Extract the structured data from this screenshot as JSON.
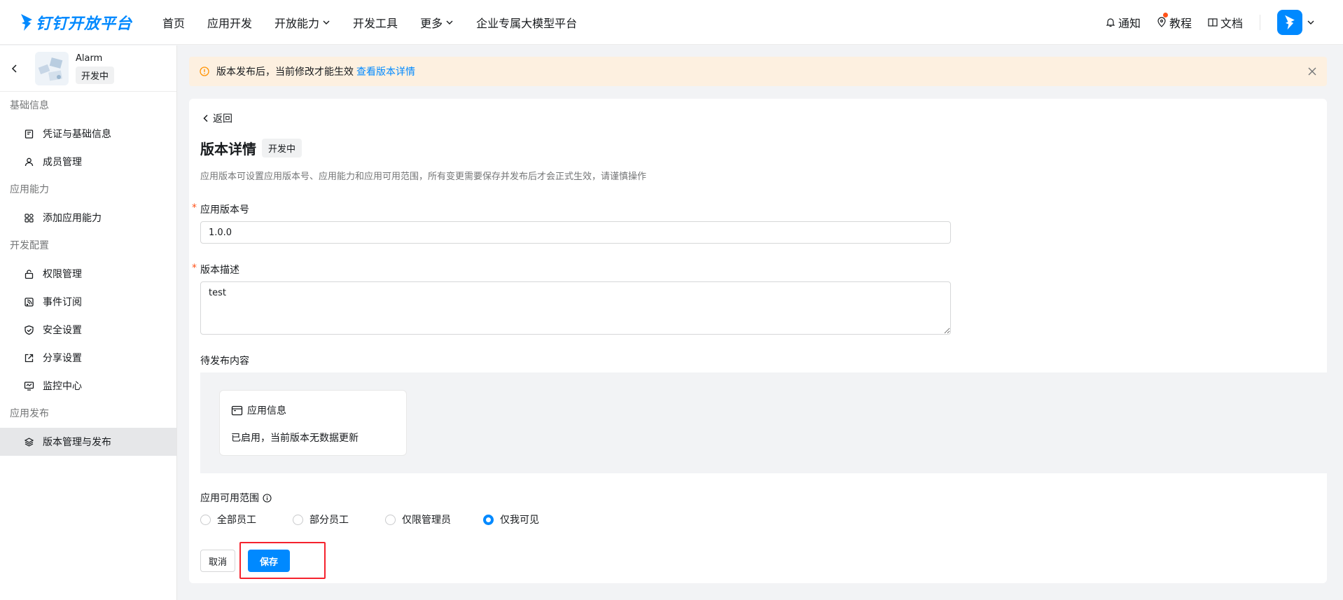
{
  "header": {
    "logo_text": "钉钉开放平台",
    "nav": [
      "首页",
      "应用开发",
      "开放能力",
      "开发工具",
      "更多",
      "企业专属大模型平台"
    ],
    "right": {
      "notify": "通知",
      "tutorial": "教程",
      "docs": "文档"
    }
  },
  "sidebar": {
    "app_name": "Alarm",
    "app_status": "开发中",
    "sections": [
      {
        "title": "基础信息",
        "items": [
          "凭证与基础信息",
          "成员管理"
        ]
      },
      {
        "title": "应用能力",
        "items": [
          "添加应用能力"
        ]
      },
      {
        "title": "开发配置",
        "items": [
          "权限管理",
          "事件订阅",
          "安全设置",
          "分享设置",
          "监控中心"
        ]
      },
      {
        "title": "应用发布",
        "items": [
          "版本管理与发布"
        ]
      }
    ]
  },
  "alert": {
    "text": "版本发布后，当前修改才能生效",
    "link": "查看版本详情"
  },
  "main": {
    "back": "返回",
    "title": "版本详情",
    "status": "开发中",
    "description": "应用版本可设置应用版本号、应用能力和应用可用范围，所有变更需要保存并发布后才会正式生效，请谨慎操作",
    "version_label": "应用版本号",
    "version_value": "1.0.0",
    "desc_label": "版本描述",
    "desc_value": "test",
    "pending_label": "待发布内容",
    "info_card": {
      "title": "应用信息",
      "body": "已启用，当前版本无数据更新"
    },
    "scope_label": "应用可用范围",
    "scope_options": [
      "全部员工",
      "部分员工",
      "仅限管理员",
      "仅我可见"
    ],
    "scope_selected": "仅我可见",
    "cancel": "取消",
    "save": "保存"
  },
  "colors": {
    "primary": "#0089ff",
    "alert_bg": "#fdf0e0",
    "warning": "#ff9200",
    "highlight": "#f5222d"
  }
}
